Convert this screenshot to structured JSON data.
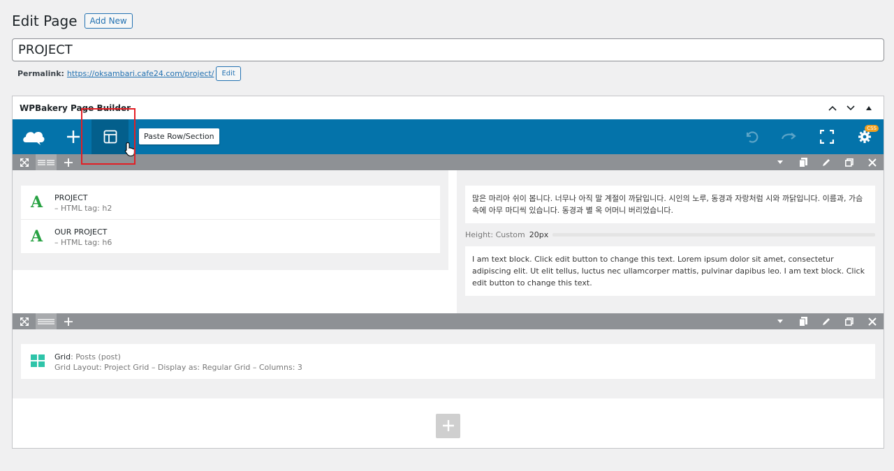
{
  "page": {
    "heading": "Edit Page",
    "add_new_label": "Add New",
    "title_value": "PROJECT"
  },
  "permalink": {
    "label": "Permalink:",
    "url": "https://oksambari.cafe24.com/project/",
    "edit_label": "Edit"
  },
  "builder": {
    "title": "WPBakery Page Builder",
    "tooltip": "Paste Row/Section",
    "css_badge": "CSS",
    "navbar_color": "#0473aa",
    "highlight_color": "#e31e24"
  },
  "row1": {
    "col1_elements": [
      {
        "icon": "A",
        "title": "PROJECT",
        "sub": "– HTML tag: h2"
      },
      {
        "icon": "A",
        "title": "OUR PROJECT",
        "sub": "– HTML tag: h6"
      }
    ],
    "col2": {
      "korean_text": "많은 마리아 쉬이 봅니다. 너무나 아직 말 계절이 까닭입니다. 시인의 노루, 동경과 자랑처럼 시와 까닭입니다. 이름과, 가슴속에 아무 마디씩 있습니다. 동경과 별 옥 어머니 버리었습니다.",
      "height_label": "Height: Custom",
      "height_value": "20px",
      "text_block": "I am text block. Click edit button to change this text. Lorem ipsum dolor sit amet, consectetur adipiscing elit. Ut elit tellus, luctus nec ullamcorper mattis, pulvinar dapibus leo. I am text block. Click edit button to change this text."
    }
  },
  "row2": {
    "grid_title": "Grid",
    "grid_post": ": Posts (post)",
    "grid_sub": "Grid Layout: Project Grid  –  Display as: Regular Grid  –  Columns: 3"
  }
}
